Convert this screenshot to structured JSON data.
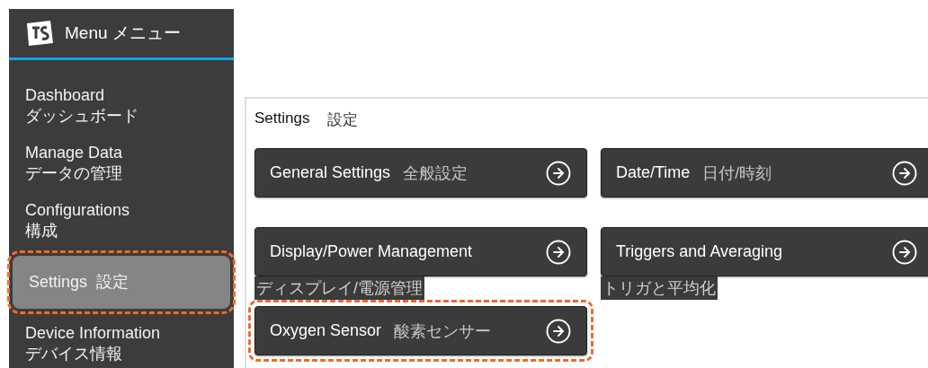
{
  "sidebar": {
    "title": "Menu メニュー",
    "items": [
      {
        "label": "Dashboard",
        "label_ja": "ダッシュボード",
        "selected": false,
        "highlighted": false
      },
      {
        "label": "Manage Data",
        "label_ja": "データの管理",
        "selected": false,
        "highlighted": false
      },
      {
        "label": "Configurations",
        "label_ja": "構成",
        "selected": false,
        "highlighted": false
      },
      {
        "label": "Settings  設定",
        "selected": true,
        "highlighted": true
      },
      {
        "label": "Device Information",
        "label_ja": "デバイス情報",
        "selected": false,
        "highlighted": false
      }
    ]
  },
  "panel": {
    "title": "Settings",
    "title_ja": "設定",
    "buttons": [
      {
        "kind": "inline",
        "label": "General Settings",
        "label_ja": "全般設定",
        "highlighted": false
      },
      {
        "kind": "inline",
        "label": "Date/Time",
        "label_ja": "日付/時刻",
        "highlighted": false
      },
      {
        "kind": "caption",
        "label": "Display/Power Management",
        "label_ja": "ディスプレイ/電源管理",
        "highlighted": false
      },
      {
        "kind": "caption",
        "label": "Triggers and Averaging",
        "label_ja": "トリガと平均化",
        "highlighted": false
      },
      {
        "kind": "inline",
        "label": "Oxygen Sensor",
        "label_ja": "酸素センサー",
        "highlighted": true
      }
    ]
  }
}
